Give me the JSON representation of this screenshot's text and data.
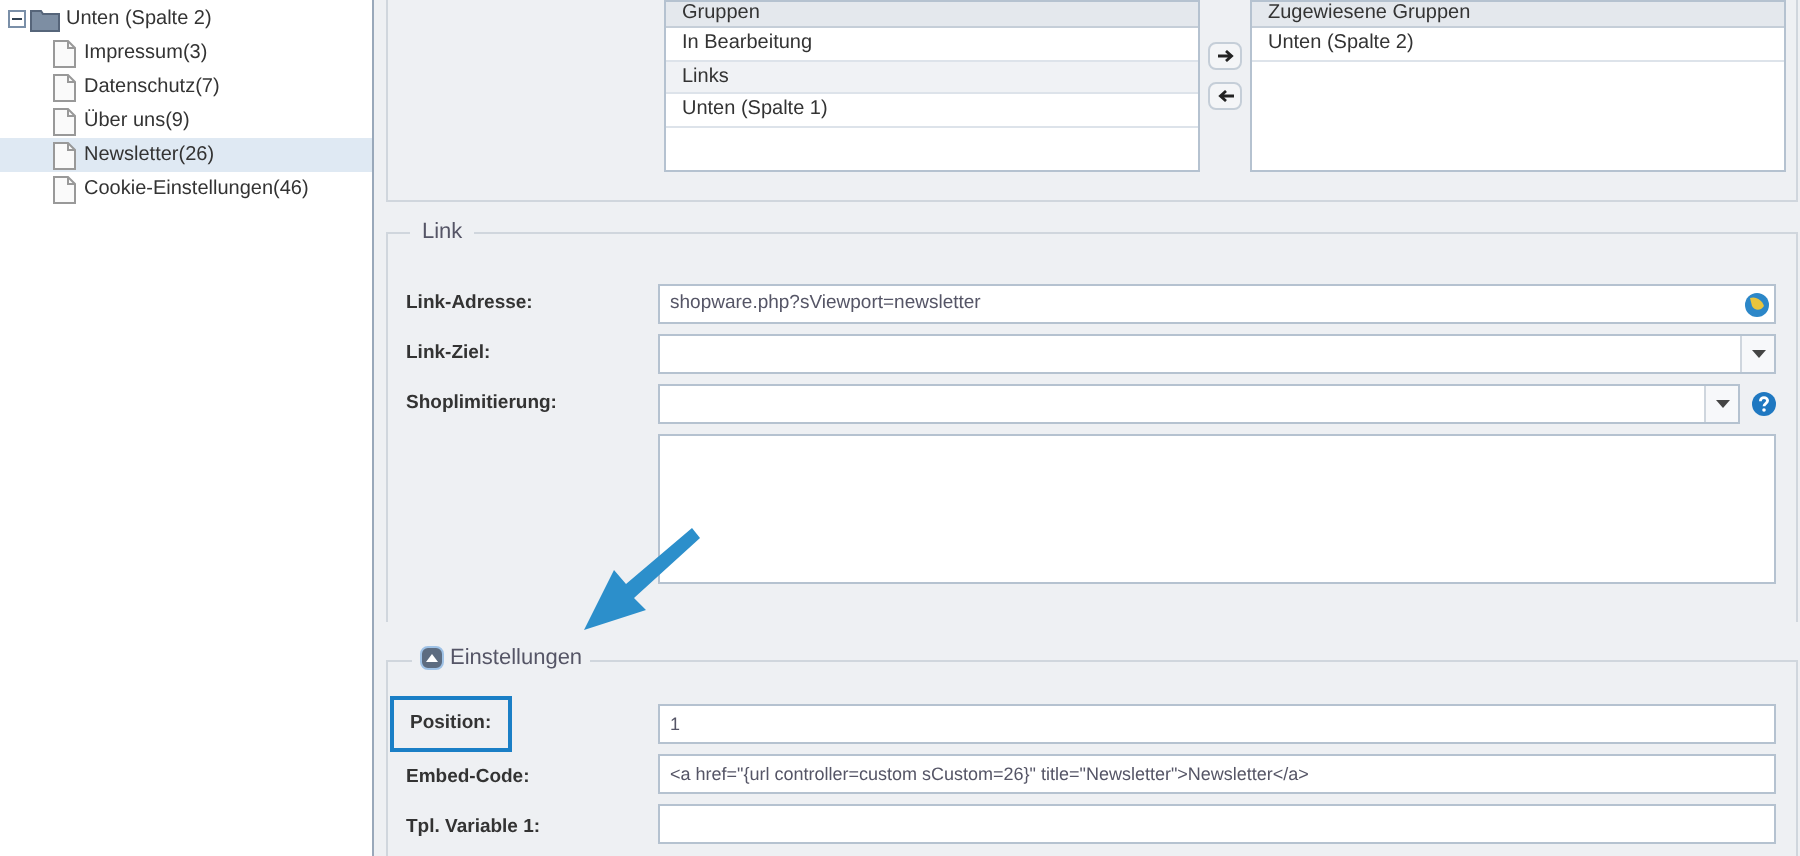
{
  "tree": {
    "label": "Unten (Spalte 2)",
    "expanded": true,
    "children": [
      {
        "label": "Impressum(3)",
        "selected": false
      },
      {
        "label": "Datenschutz(7)",
        "selected": false
      },
      {
        "label": "Über uns(9)",
        "selected": false
      },
      {
        "label": "Newsletter(26)",
        "selected": true
      },
      {
        "label": "Cookie-Einstellungen(46)",
        "selected": false
      }
    ]
  },
  "groups": {
    "available": {
      "title": "Gruppen",
      "items": [
        {
          "label": "In Bearbeitung",
          "selected": false
        },
        {
          "label": "Links",
          "selected": true
        },
        {
          "label": "Unten (Spalte 1)",
          "selected": false
        }
      ]
    },
    "assigned": {
      "title": "Zugewiesene Gruppen",
      "items": [
        {
          "label": "Unten (Spalte 2)",
          "selected": false
        }
      ]
    }
  },
  "link_section": {
    "legend": "Link",
    "fields": [
      {
        "kind": "text",
        "label": "Link-Adresse:",
        "value": "shopware.php?sViewport=newsletter"
      },
      {
        "kind": "select",
        "label": "Link-Ziel:"
      },
      {
        "kind": "select-help",
        "label": "Shoplimitierung:"
      },
      {
        "kind": "textarea"
      }
    ]
  },
  "settings_section": {
    "legend": "Einstellungen",
    "expanded": true,
    "fields": [
      {
        "label": "Position:",
        "value": "1",
        "highlighted": true
      },
      {
        "label": "Embed-Code:",
        "value": "<a href=\"{url controller=custom sCustom=26}\" title=\"Newsletter\">Newsletter</a>",
        "highlighted": false
      },
      {
        "label": "Tpl. Variable 1:",
        "highlighted": false
      }
    ]
  }
}
